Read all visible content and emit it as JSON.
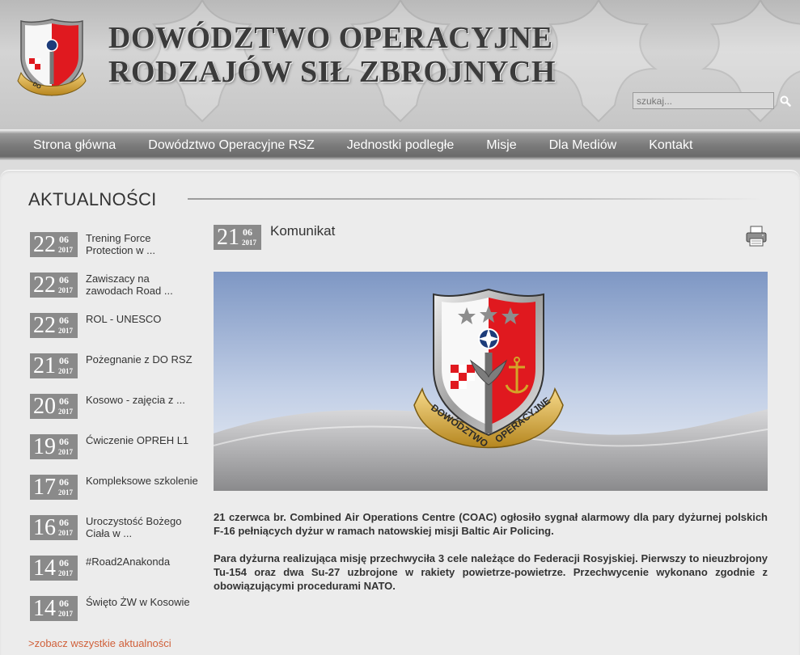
{
  "header": {
    "title_line1": "DOWÓDZTWO OPERACYJNE",
    "title_line2": "RODZAJÓW SIŁ ZBROJNYCH",
    "logo_text": "DOWÓDZTWO OPERACYJNE",
    "search": {
      "placeholder": "szukaj..."
    }
  },
  "nav": {
    "items": [
      {
        "label": "Strona główna"
      },
      {
        "label": "Dowództwo Operacyjne RSZ"
      },
      {
        "label": "Jednostki podległe"
      },
      {
        "label": "Misje"
      },
      {
        "label": "Dla Mediów"
      },
      {
        "label": "Kontakt"
      }
    ]
  },
  "news": {
    "section_title": "AKTUALNOŚCI",
    "items": [
      {
        "day": "22",
        "month": "06",
        "year": "2017",
        "title": "Trening Force Protection w ..."
      },
      {
        "day": "22",
        "month": "06",
        "year": "2017",
        "title": "Zawiszacy na zawodach Road ..."
      },
      {
        "day": "22",
        "month": "06",
        "year": "2017",
        "title": "ROL - UNESCO"
      },
      {
        "day": "21",
        "month": "06",
        "year": "2017",
        "title": "Pożegnanie z DO RSZ"
      },
      {
        "day": "20",
        "month": "06",
        "year": "2017",
        "title": "Kosowo - zajęcia z ..."
      },
      {
        "day": "19",
        "month": "06",
        "year": "2017",
        "title": "Ćwiczenie OPREH L1"
      },
      {
        "day": "17",
        "month": "06",
        "year": "2017",
        "title": "Kompleksowe szkolenie"
      },
      {
        "day": "16",
        "month": "06",
        "year": "2017",
        "title": "Uroczystość Bożego Ciała w ..."
      },
      {
        "day": "14",
        "month": "06",
        "year": "2017",
        "title": "#Road2Anakonda"
      },
      {
        "day": "14",
        "month": "06",
        "year": "2017",
        "title": "Święto ŻW w Kosowie"
      }
    ],
    "more_label": ">zobacz wszystkie aktualności"
  },
  "article": {
    "day": "21",
    "month": "06",
    "year": "2017",
    "title": "Komunikat",
    "hero_badge_text": "DOWÓDZTWO OPERACYJNE",
    "paragraphs": [
      "21 czerwca br. Combined Air Operations Centre (COAC) ogłosiło sygnał alarmowy dla pary dyżurnej polskich F-16 pełniących dyżur w ramach natowskiej misji Baltic Air Policing.",
      "Para dyżurna realizująca misję przechwyciła 3 cele należące do Federacji Rosyjskiej. Pierwszy to nieuzbrojony  Tu-154 oraz dwa Su-27 uzbrojone w rakiety powietrze-powietrze. Przechwycenie wykonano zgodnie z obowiązującymi procedurami NATO."
    ]
  },
  "colors": {
    "nav_bg": "#7b7b7b",
    "date_box": "#8a8a8a",
    "link_accent": "#d0603a",
    "badge_red": "#e0191f",
    "badge_gold": "#d4a528"
  }
}
